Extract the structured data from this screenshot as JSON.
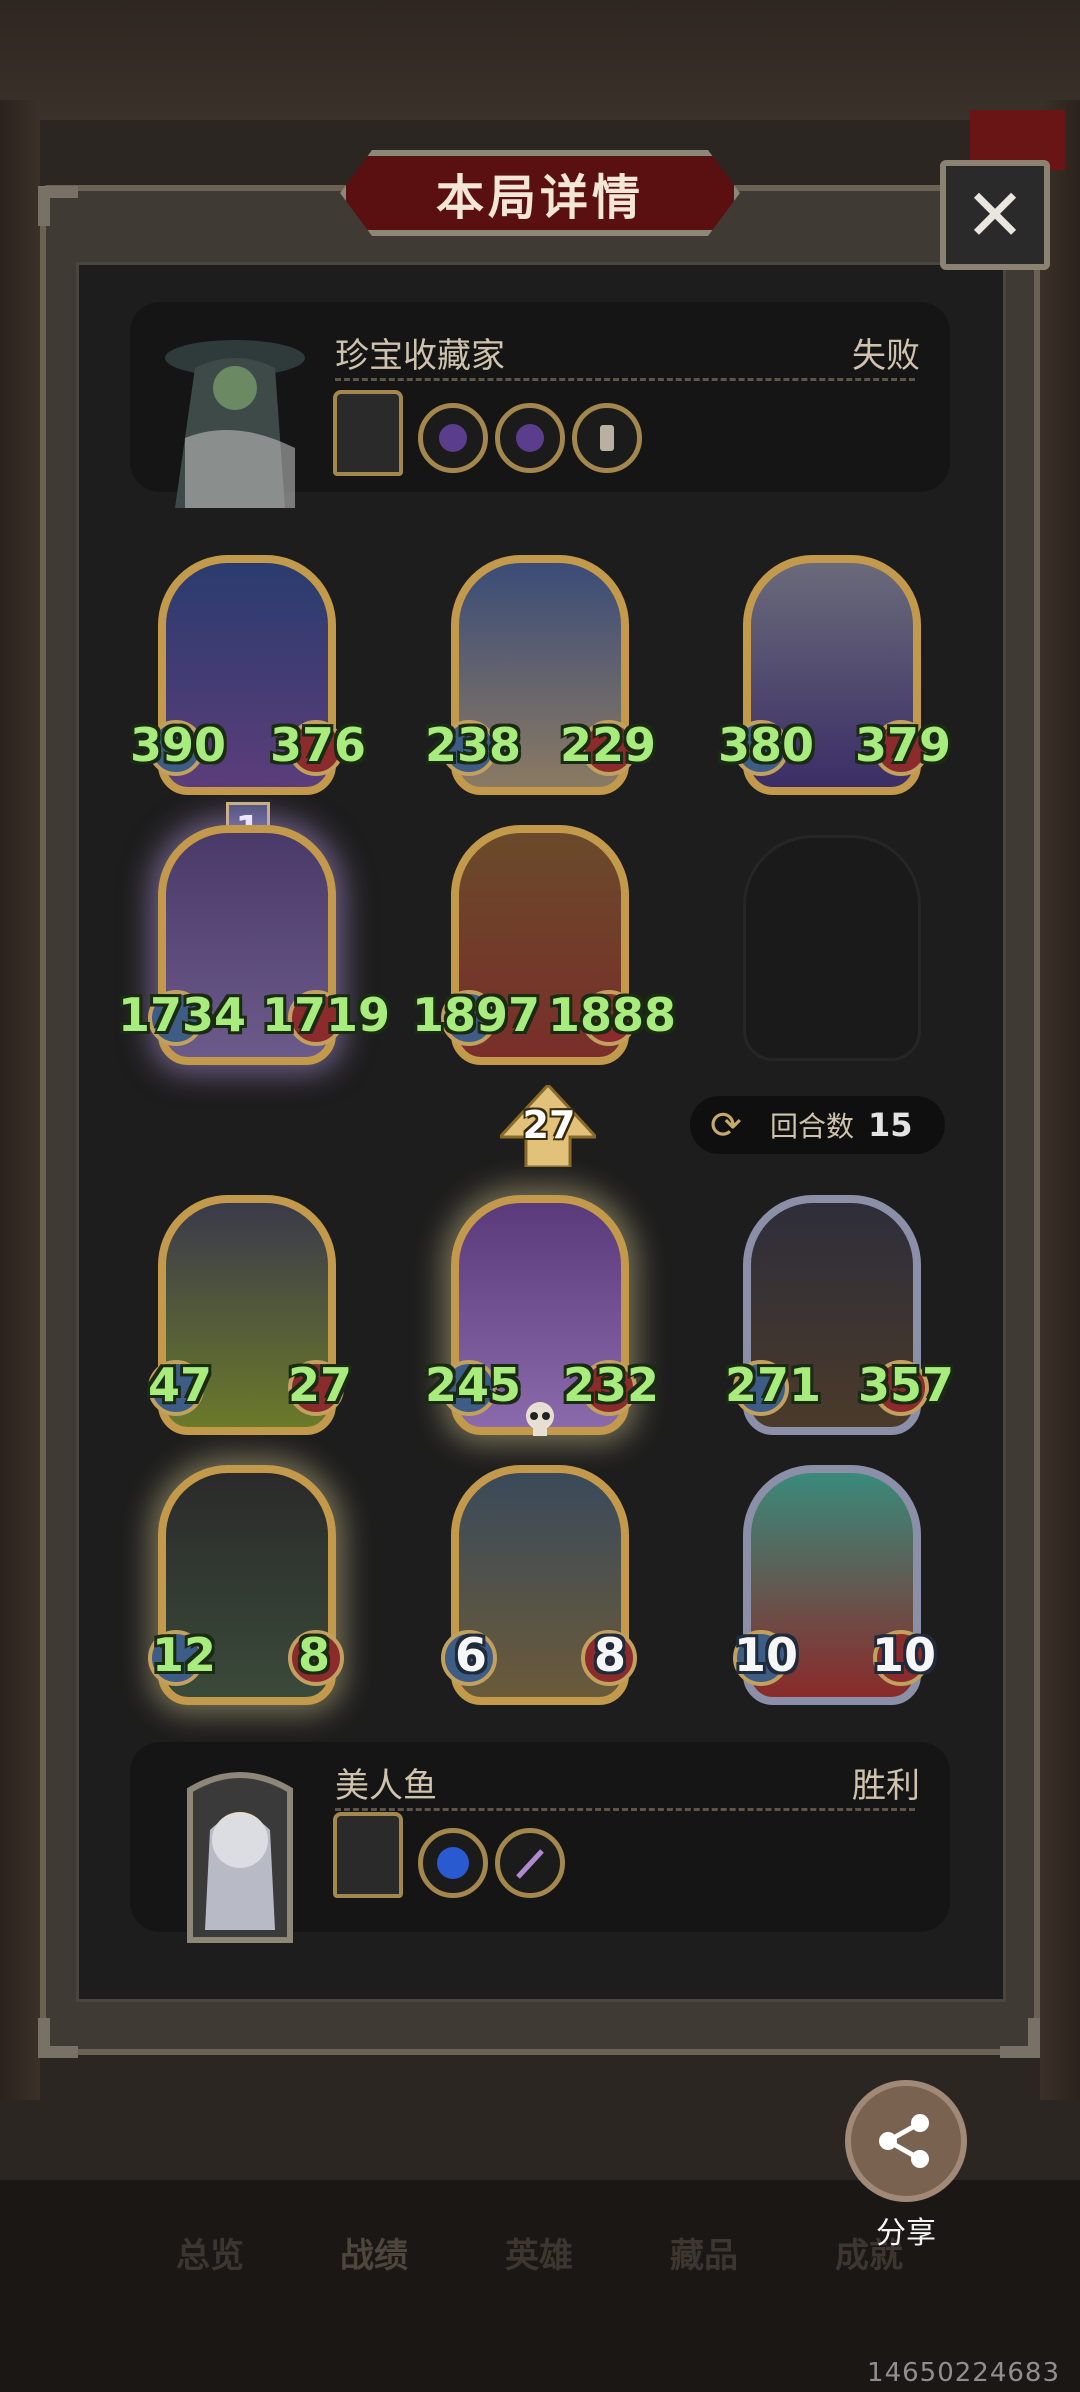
{
  "dialog": {
    "title": "本局详情",
    "close_label": "✕"
  },
  "opponent": {
    "name": "珍宝收藏家",
    "result": "失败",
    "items": [
      "minion-card-item",
      "purple-orb-item",
      "purple-orb-item",
      "scroll-item"
    ]
  },
  "player": {
    "name": "美人鱼",
    "result": "胜利",
    "items": [
      "minion-card-item",
      "blue-orb-item",
      "purple-staff-item"
    ]
  },
  "opponent_board": [
    {
      "attack": "390",
      "health": "376"
    },
    {
      "attack": "238",
      "health": "229"
    },
    {
      "attack": "380",
      "health": "379"
    },
    {
      "attack": "1734",
      "health": "1719",
      "tier": "1"
    },
    {
      "attack": "1897",
      "health": "1888"
    }
  ],
  "player_board": [
    {
      "attack": "47",
      "health": "27"
    },
    {
      "attack": "245",
      "health": "232"
    },
    {
      "attack": "271",
      "health": "357"
    },
    {
      "attack": "12",
      "health": "8"
    },
    {
      "attack": "6",
      "health": "8"
    },
    {
      "attack": "10",
      "health": "10"
    }
  ],
  "damage": "27",
  "turns": {
    "label": "回合数",
    "value": "15"
  },
  "share": {
    "label": "分享"
  },
  "nav": [
    "总览",
    "战绩",
    "英雄",
    "藏品",
    "成就"
  ],
  "uid": "14650224683"
}
